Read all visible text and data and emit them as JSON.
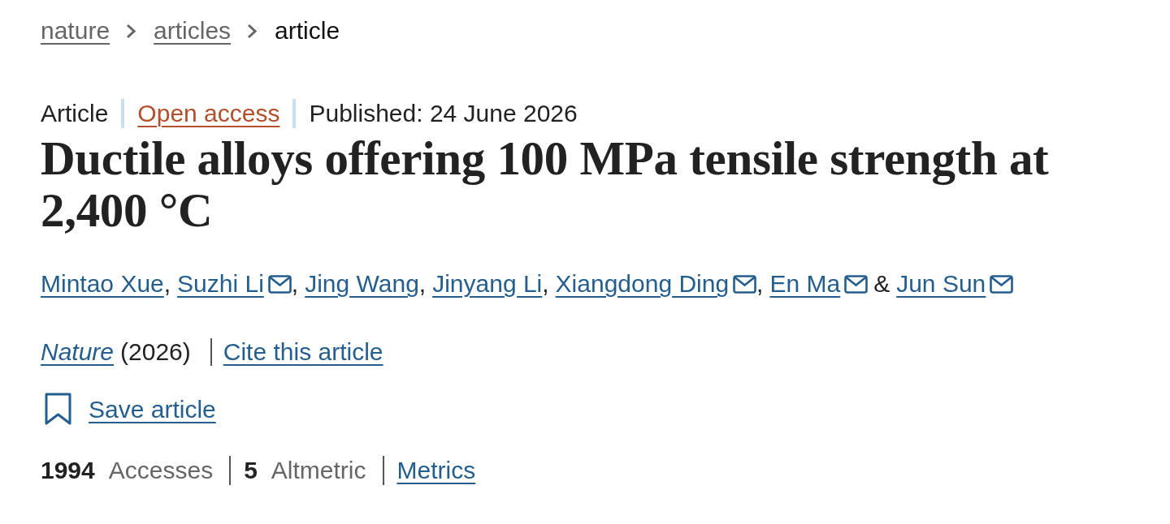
{
  "breadcrumbs": [
    {
      "label": "nature",
      "current": false
    },
    {
      "label": "articles",
      "current": false
    },
    {
      "label": "article",
      "current": true
    }
  ],
  "meta": {
    "type": "Article",
    "access": "Open access",
    "published": "Published: 24 June 2026"
  },
  "title": "Ductile alloys offering 100 MPa tensile strength at 2,400 °C",
  "authors": [
    {
      "name": "Mintao Xue",
      "email": false,
      "after": ","
    },
    {
      "name": "Suzhi Li",
      "email": true,
      "after": ","
    },
    {
      "name": "Jing Wang",
      "email": false,
      "after": ","
    },
    {
      "name": "Jinyang Li",
      "email": false,
      "after": ","
    },
    {
      "name": "Xiangdong Ding",
      "email": true,
      "after": ","
    },
    {
      "name": "En Ma",
      "email": true,
      "after": "&"
    },
    {
      "name": "Jun Sun",
      "email": true
    }
  ],
  "citation": {
    "journal": "Nature",
    "year": "(2026)",
    "cite_link": "Cite this article"
  },
  "save": {
    "label": "Save article"
  },
  "metrics": [
    {
      "count": "1994",
      "metric": "Accesses"
    },
    {
      "count": "5",
      "metric": "Altmetric"
    }
  ],
  "metrics_link": "Metrics"
}
